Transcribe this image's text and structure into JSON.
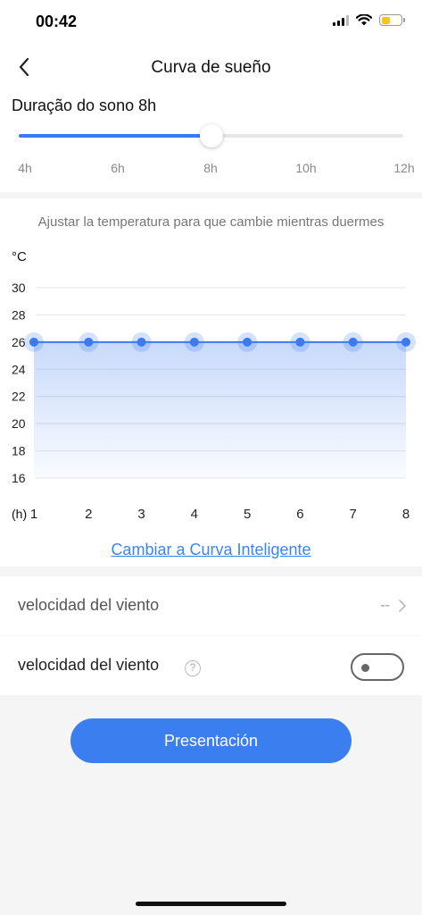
{
  "status_bar": {
    "time": "00:42",
    "battery_level": 0.45
  },
  "nav": {
    "title": "Curva de sueño",
    "back_icon": "chevron-left-icon"
  },
  "duration": {
    "title": "Duração do sono 8h",
    "value_hours": 8,
    "min_hours": 4,
    "max_hours": 12,
    "ticks": [
      "4h",
      "6h",
      "8h",
      "10h",
      "12h"
    ],
    "accent_color": "#3b7af0"
  },
  "temperature_curve": {
    "description": "Ajustar la temperatura para que cambie mientras duermes",
    "switch_link": "Cambiar a Curva Inteligente"
  },
  "chart_data": {
    "type": "area",
    "ylabel": "°C",
    "xlabel": "(h)",
    "x": [
      1,
      2,
      3,
      4,
      5,
      6,
      7,
      8
    ],
    "values": [
      26,
      26,
      26,
      26,
      26,
      26,
      26,
      26
    ],
    "ylim": [
      16,
      30
    ],
    "yticks": [
      30,
      28,
      26,
      24,
      22,
      20,
      18,
      16
    ],
    "grid": true,
    "color": "#3b7af0"
  },
  "settings": {
    "wind_row_1": {
      "label": "velocidad del viento",
      "value": "--"
    },
    "wind_row_2": {
      "label": "velocidad del viento",
      "help_icon": "question-circle-icon",
      "toggle_on": false
    }
  },
  "action": {
    "present_label": "Presentación",
    "color": "#3b7ef0"
  }
}
